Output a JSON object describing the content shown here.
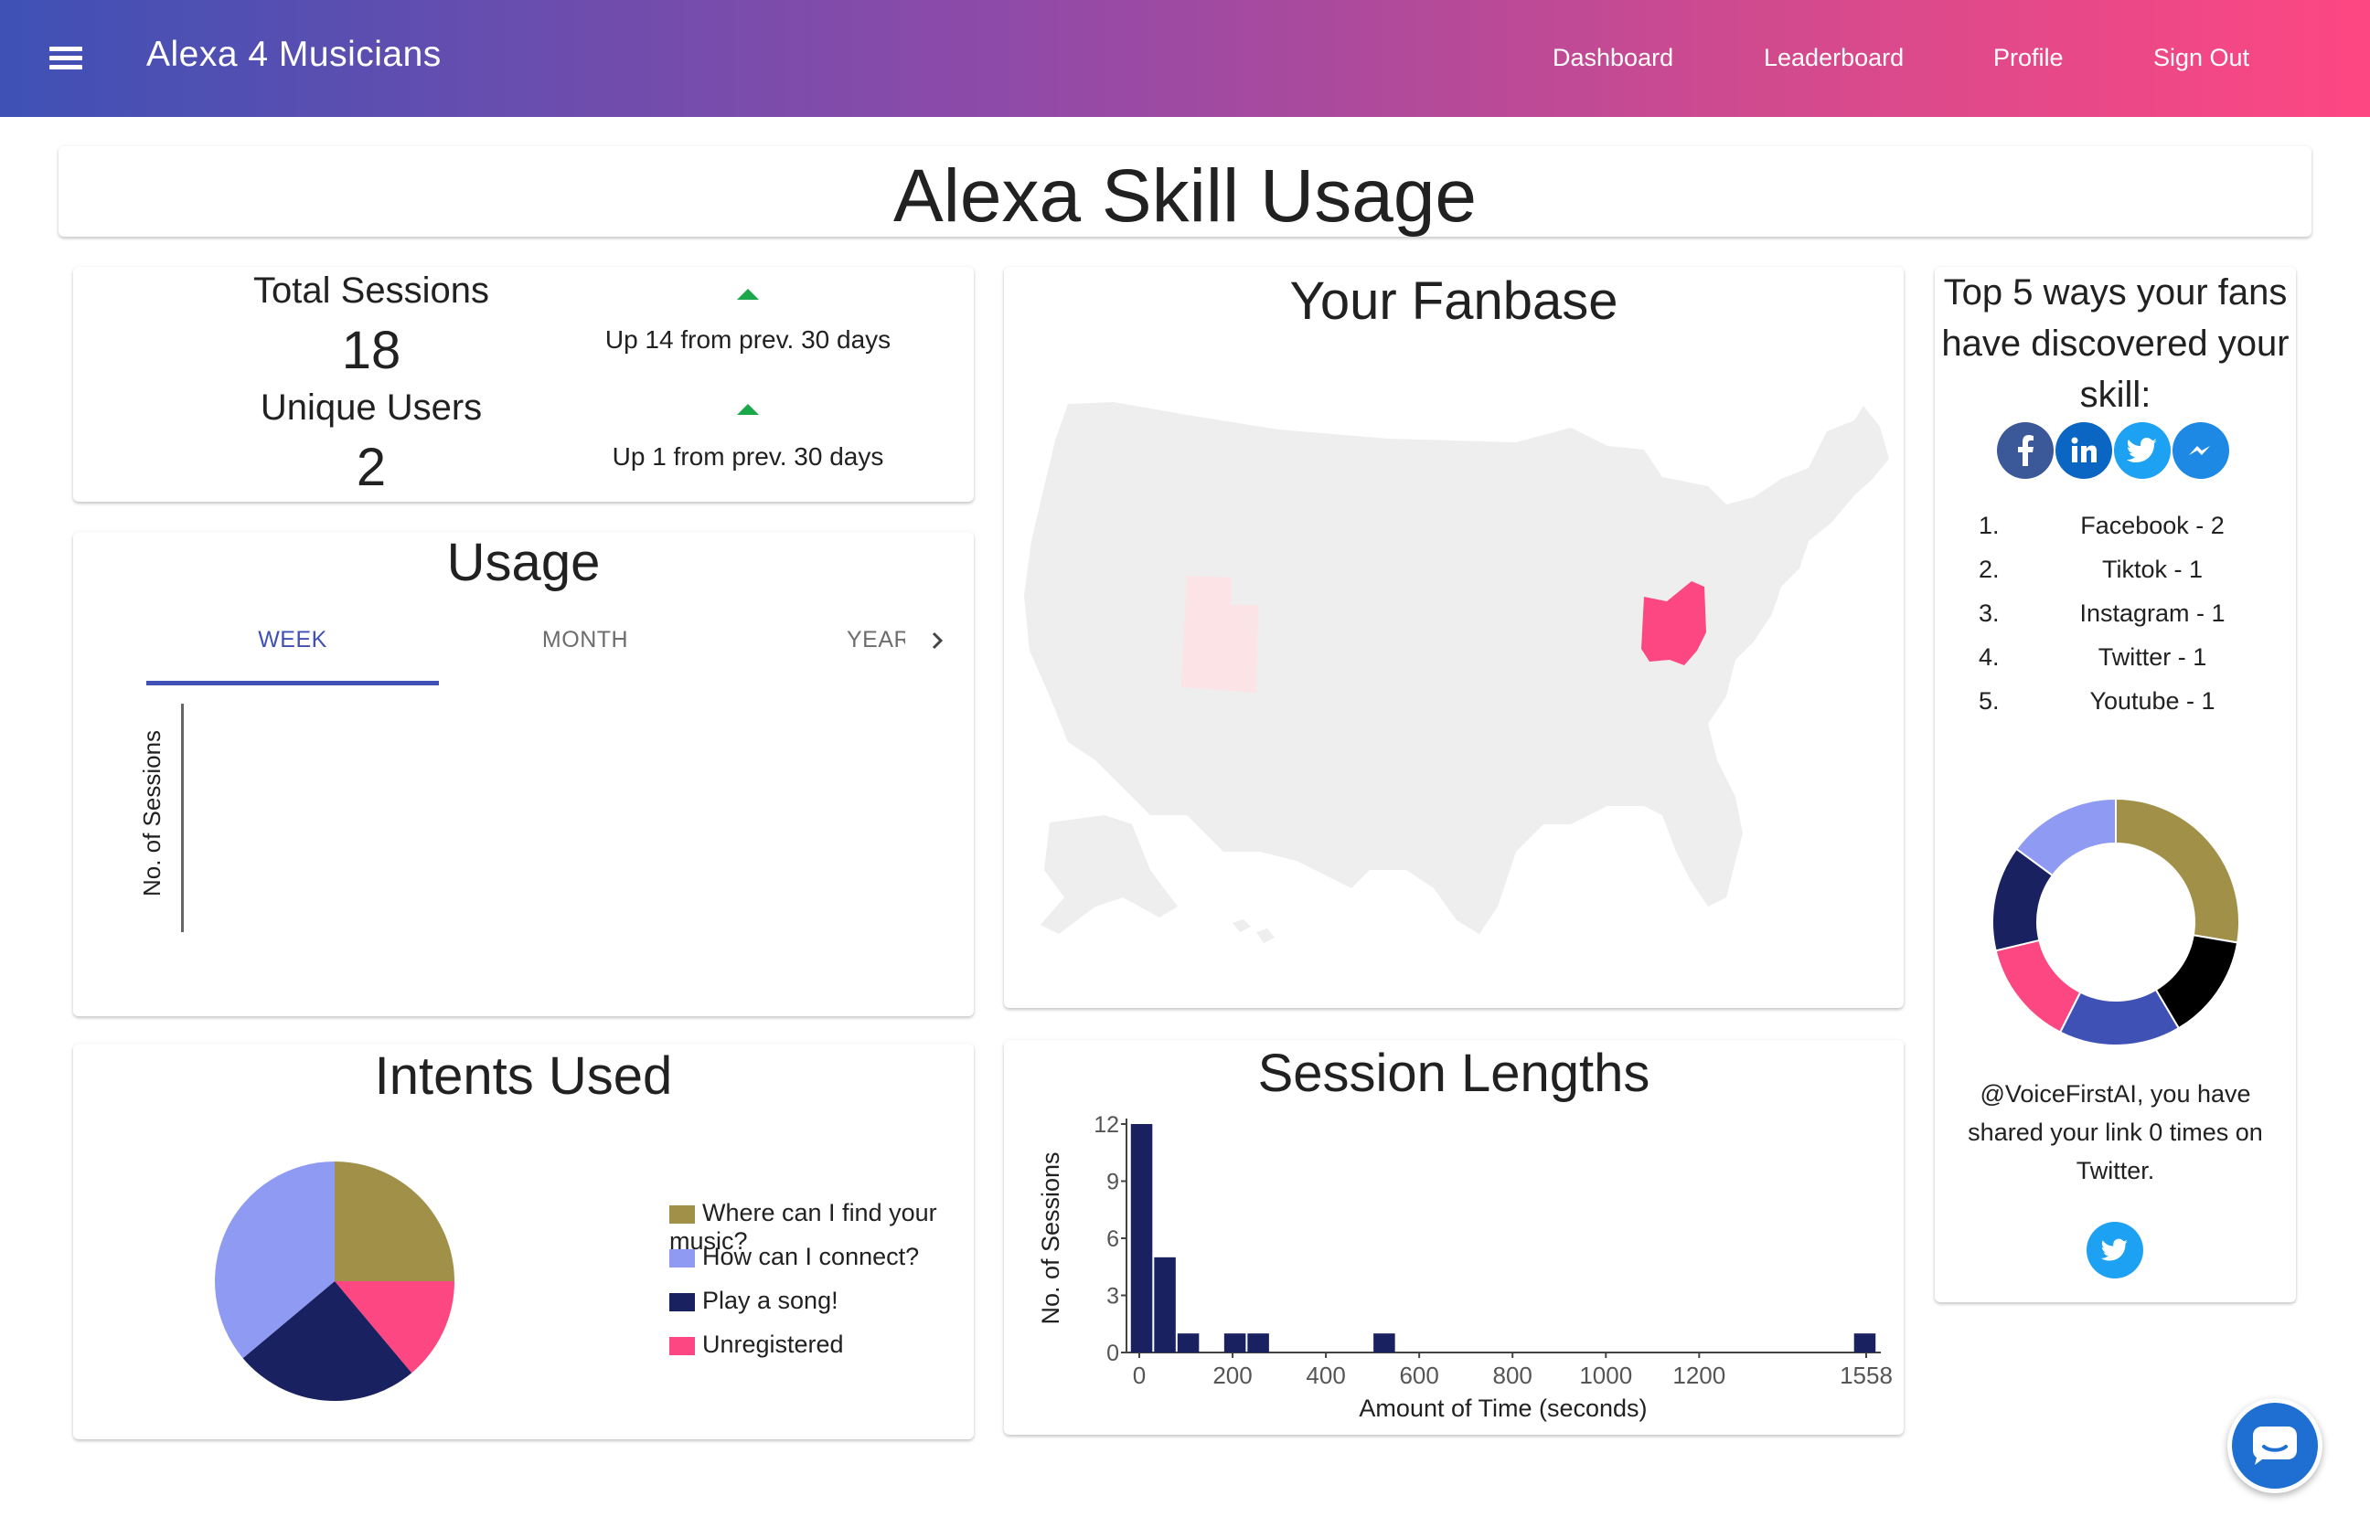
{
  "app": {
    "title": "Alexa 4 Musicians"
  },
  "nav": {
    "dashboard": "Dashboard",
    "leaderboard": "Leaderboard",
    "profile": "Profile",
    "sign_out": "Sign Out"
  },
  "page": {
    "title": "Alexa Skill Usage"
  },
  "stats": {
    "total_sessions_label": "Total Sessions",
    "total_sessions_value": "18",
    "total_sessions_trend": "Up 14 from prev. 30 days",
    "unique_users_label": "Unique Users",
    "unique_users_value": "2",
    "unique_users_trend": "Up 1 from prev. 30 days",
    "trend_color": "#1aa84a"
  },
  "usage": {
    "title": "Usage",
    "tabs": [
      "WEEK",
      "MONTH",
      "YEAR"
    ],
    "active_tab": "WEEK",
    "ylabel": "No. of Sessions"
  },
  "fanbase": {
    "title": "Your Fanbase",
    "highlighted_states": [
      {
        "state": "Ohio",
        "color": "#fd4782"
      },
      {
        "state": "Utah",
        "color": "#fbe3e6"
      }
    ]
  },
  "discover": {
    "title": "Top 5 ways your fans have discovered your skill:",
    "icons": [
      "facebook-icon",
      "linkedin-icon",
      "twitter-icon",
      "messenger-icon"
    ],
    "items": [
      {
        "rank": "1.",
        "label": "Facebook - 2"
      },
      {
        "rank": "2.",
        "label": "Tiktok - 1"
      },
      {
        "rank": "3.",
        "label": "Instagram - 1"
      },
      {
        "rank": "4.",
        "label": "Twitter - 1"
      },
      {
        "rank": "5.",
        "label": "Youtube - 1"
      }
    ],
    "share_text": "@VoiceFirstAI, you have shared your link 0 times on Twitter."
  },
  "chart_data": [
    {
      "type": "pie",
      "title": "Intents Used",
      "labels": [
        "Where can I find your music?",
        "How can I connect?",
        "Play a song!",
        "Unregistered"
      ],
      "values": [
        4.5,
        6.5,
        4.5,
        2.5
      ],
      "colors": [
        "#a19048",
        "#8f9bf2",
        "#192161",
        "#fd4782"
      ]
    },
    {
      "type": "bar",
      "title": "Session Lengths",
      "xlabel": "Amount of Time (seconds)",
      "ylabel": "No. of Sessions",
      "x_ticks": [
        "0",
        "200",
        "400",
        "600",
        "800",
        "1000",
        "1200",
        "1558"
      ],
      "y_ticks": [
        "0",
        "3",
        "6",
        "9",
        "12"
      ],
      "xlim": [
        0,
        1558
      ],
      "ylim": [
        0,
        12
      ],
      "bins": [
        {
          "x0": -20,
          "x1": 30,
          "value": 12
        },
        {
          "x0": 30,
          "x1": 80,
          "value": 5
        },
        {
          "x0": 80,
          "x1": 130,
          "value": 1
        },
        {
          "x0": 180,
          "x1": 230,
          "value": 1
        },
        {
          "x0": 230,
          "x1": 280,
          "value": 1
        },
        {
          "x0": 500,
          "x1": 550,
          "value": 1
        },
        {
          "x0": 1530,
          "x1": 1580,
          "value": 1
        }
      ],
      "color": "#192161"
    },
    {
      "type": "pie",
      "title": "",
      "donut": true,
      "labels": [],
      "values": [
        26,
        13,
        15,
        13,
        13,
        14
      ],
      "colors": [
        "#a19048",
        "#000000",
        "#3f51b5",
        "#fd4782",
        "#192161",
        "#8f9bf2"
      ]
    }
  ]
}
